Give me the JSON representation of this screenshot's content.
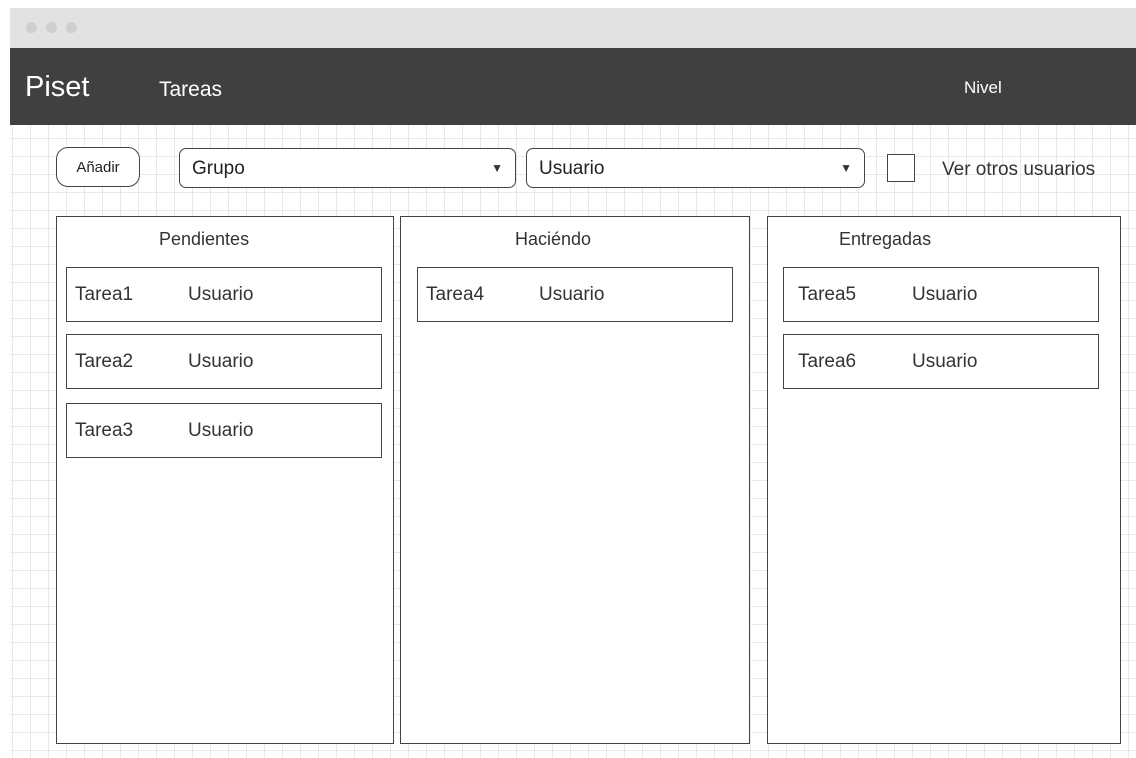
{
  "nav": {
    "brand": "Piset",
    "tasks_link": "Tareas",
    "level_link": "Nivel"
  },
  "toolbar": {
    "add_label": "Añadir",
    "group_select": "Grupo",
    "user_select": "Usuario",
    "show_others_label": "Ver otros usuarios",
    "show_others_checked": false
  },
  "columns": [
    {
      "title": "Pendientes",
      "cards": [
        {
          "task": "Tarea1",
          "user": "Usuario"
        },
        {
          "task": "Tarea2",
          "user": "Usuario"
        },
        {
          "task": "Tarea3",
          "user": "Usuario"
        }
      ]
    },
    {
      "title": "Haciéndo",
      "cards": [
        {
          "task": "Tarea4",
          "user": "Usuario"
        }
      ]
    },
    {
      "title": "Entregadas",
      "cards": [
        {
          "task": "Tarea5",
          "user": "Usuario"
        },
        {
          "task": "Tarea6",
          "user": "Usuario"
        }
      ]
    }
  ],
  "colors": {
    "navbar": "#404040",
    "titlebar": "#e2e2e2",
    "grid": "#e8e8e8"
  }
}
